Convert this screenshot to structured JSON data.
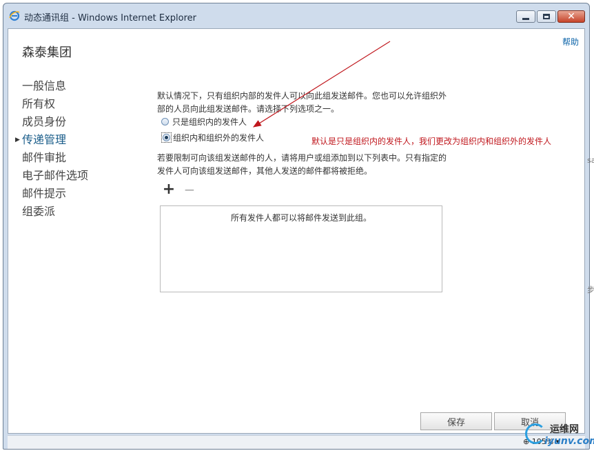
{
  "window": {
    "title": "动态通讯组 - Windows Internet Explorer",
    "minimize_label": "",
    "maximize_label": "",
    "close_label": "✕"
  },
  "header": {
    "help": "帮助",
    "org_name": "森泰集团"
  },
  "nav": {
    "items": [
      {
        "label": "一般信息"
      },
      {
        "label": "所有权"
      },
      {
        "label": "成员身份"
      },
      {
        "label": "传递管理"
      },
      {
        "label": "邮件审批"
      },
      {
        "label": "电子邮件选项"
      },
      {
        "label": "邮件提示"
      },
      {
        "label": "组委派"
      }
    ],
    "active_index": 3
  },
  "delivery": {
    "description": "默认情况下，只有组织内部的发件人可以向此组发送邮件。您也可以允许组织外部的人员向此组发送邮件。请选择下列选项之一。",
    "option_internal": "只是组织内的发件人",
    "option_all": "组织内和组织外的发件人",
    "selected_option": "option_all",
    "restrict_text": "若要限制可向该组发送邮件的人，请将用户或组添加到以下列表中。只有指定的发件人可向该组发送邮件，其他人发送的邮件都将被拒绝。",
    "add_icon": "+",
    "remove_icon": "−",
    "empty_list_text": "所有发件人都可以将邮件发送到此组。"
  },
  "annotation": {
    "text": "默认是只是组织内的发件人，我们更改为组织内和组织外的发件人",
    "color": "#c0171d"
  },
  "buttons": {
    "save": "保存",
    "cancel": "取消"
  },
  "status": {
    "zoom": "105%"
  },
  "watermark": {
    "line1": "运维网",
    "line2": "iyunv.com"
  },
  "edge_fragments": {
    "a": "sa",
    "b": "步"
  },
  "colors": {
    "link": "#0b63a8",
    "active_nav": "#1a5d8a",
    "frame": "#cfdcec"
  }
}
